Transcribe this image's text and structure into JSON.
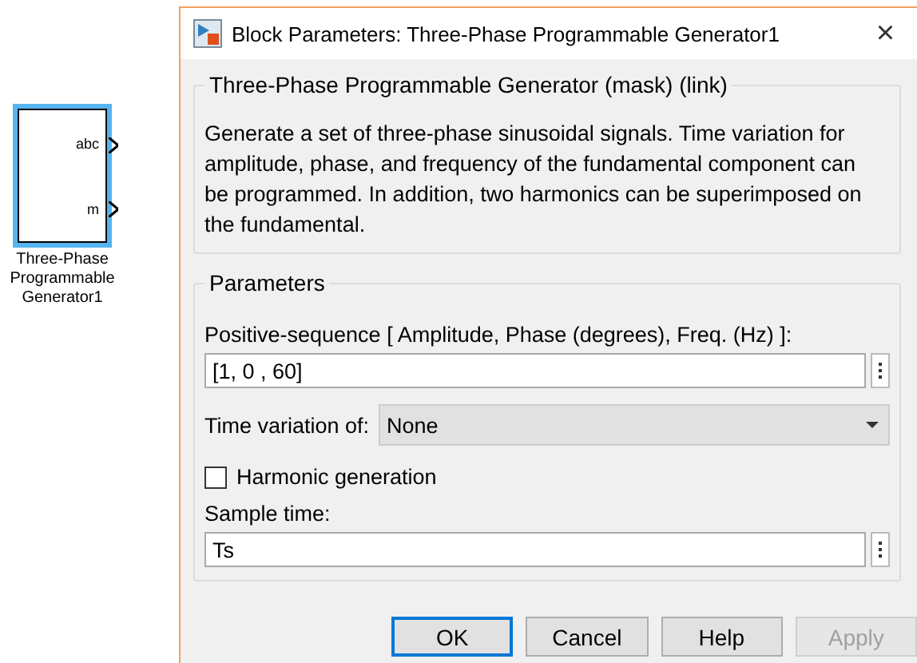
{
  "block": {
    "ports": [
      "abc",
      "m"
    ],
    "label": "Three-Phase Programmable Generator1",
    "selected": true
  },
  "dialog": {
    "title": "Block Parameters: Three-Phase Programmable Generator1",
    "close": "×",
    "mask": {
      "title": "Three-Phase Programmable Generator (mask) (link)",
      "description": "Generate a set of three-phase sinusoidal signals. Time variation for amplitude, phase, and frequency of the fundamental component can be programmed. In addition, two harmonics can be superimposed on the fundamental."
    },
    "parameters": {
      "title": "Parameters",
      "fields": [
        {
          "kind": "text",
          "label": "Positive-sequence [ Amplitude, Phase (degrees), Freq. (Hz) ]:",
          "value": "[1, 0 , 60]"
        },
        {
          "kind": "dropdown",
          "label": "Time variation of:",
          "value": "None"
        },
        {
          "kind": "checkbox",
          "label": "Harmonic generation",
          "checked": false
        },
        {
          "kind": "text",
          "label": "Sample time:",
          "value": "Ts"
        }
      ]
    },
    "buttons": [
      {
        "label": "OK",
        "focused": true,
        "disabled": false
      },
      {
        "label": "Cancel",
        "focused": false,
        "disabled": false
      },
      {
        "label": "Help",
        "focused": false,
        "disabled": false
      },
      {
        "label": "Apply",
        "focused": false,
        "disabled": true
      }
    ]
  }
}
